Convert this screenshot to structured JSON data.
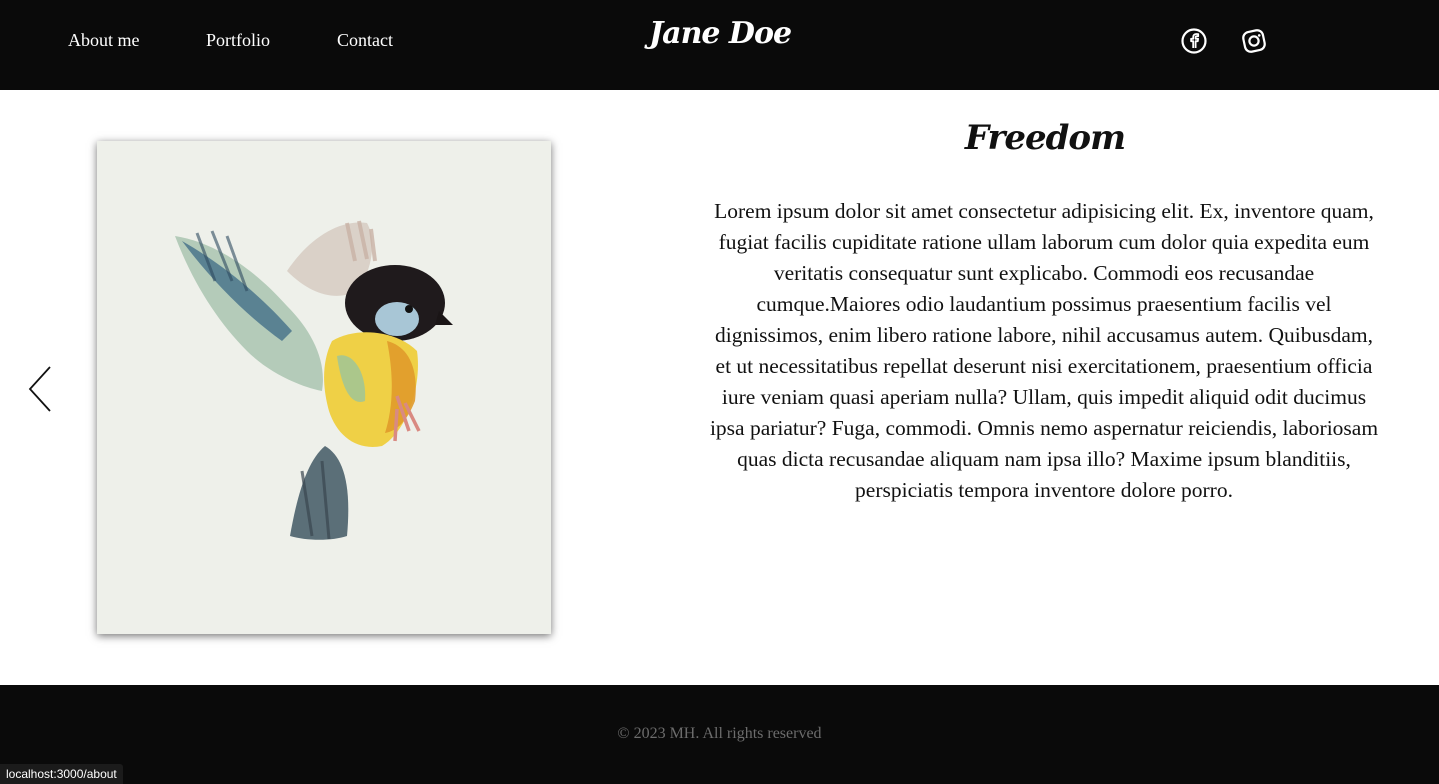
{
  "header": {
    "nav": [
      {
        "label": "About me"
      },
      {
        "label": "Portfolio"
      },
      {
        "label": "Contact"
      }
    ],
    "logo": "Jane Doe",
    "social": [
      {
        "icon": "facebook-icon"
      },
      {
        "icon": "instagram-icon"
      }
    ]
  },
  "artwork": {
    "title": "Freedom",
    "description": "Lorem ipsum dolor sit amet consectetur adipisicing elit. Ex, inventore quam, fugiat facilis cupiditate ratione ullam laborum cum dolor quia expedita eum veritatis consequatur sunt explicabo. Commodi eos recusandae cumque.Maiores odio laudantium possimus praesentium facilis vel dignissimos, enim libero ratione labore, nihil accusamus autem. Quibusdam, et ut necessitatibus repellat deserunt nisi exercitationem, praesentium officia iure veniam quasi aperiam nulla? Ullam, quis impedit aliquid odit ducimus ipsa pariatur? Fuga, commodi. Omnis nemo aspernatur reiciendis, laboriosam quas dicta recusandae aliquam nam ipsa illo? Maxime ipsum blanditiis, perspiciatis tempora inventore dolore porro.",
    "prev_icon": "chevron-left-icon"
  },
  "footer": {
    "copyright": "© 2023 MH. All rights reserved"
  },
  "status_bar": {
    "url": "localhost:3000/about"
  },
  "colors": {
    "header_bg": "#0a0a0a",
    "footer_bg": "#0a0a0a",
    "text": "#111111",
    "footer_text": "#6c6c6c"
  }
}
